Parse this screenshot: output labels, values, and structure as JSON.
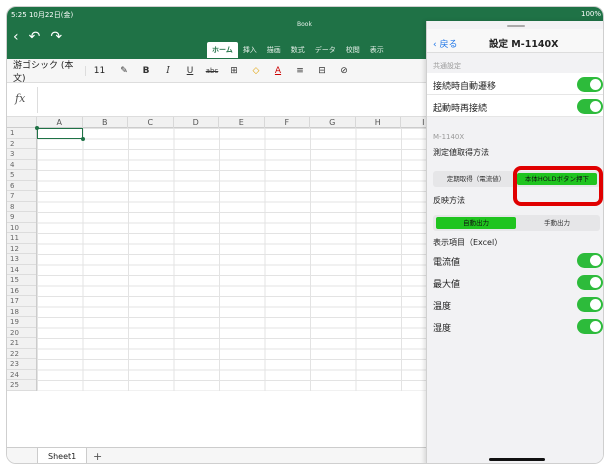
{
  "status": {
    "time": "5:25 10月22日(金)",
    "battery": "100%"
  },
  "doc_title": "Book",
  "ribbon_tabs": [
    "ホーム",
    "挿入",
    "描画",
    "数式",
    "データ",
    "校閲",
    "表示"
  ],
  "toolbar": {
    "font": "游ゴシック (本文)",
    "size": "11",
    "bold": "B",
    "italic": "I",
    "underline": "U",
    "strike": "abc"
  },
  "formula": {
    "fx": "fx"
  },
  "columns": [
    "A",
    "B",
    "C",
    "D",
    "E",
    "F",
    "G",
    "H",
    "I"
  ],
  "rows": [
    "1",
    "2",
    "3",
    "4",
    "5",
    "6",
    "7",
    "8",
    "9",
    "10",
    "11",
    "12",
    "13",
    "14",
    "15",
    "16",
    "17",
    "18",
    "19",
    "20",
    "21",
    "22",
    "23",
    "24",
    "25"
  ],
  "sheet_tab": "Sheet1",
  "add_sheet": "+",
  "panel": {
    "back": "戻る",
    "title": "設定 M-1140X",
    "common_section": "共通設定",
    "auto_transition": "接続時自動遷移",
    "auto_reconnect": "起動時再接続",
    "device_section": "M-1140X",
    "measure_method": "測定値取得方法",
    "periodic": "定期取得（電流値）",
    "hold_button": "本体HOLDボタン押下",
    "reflect_method": "反映方法",
    "auto_output": "自動出力",
    "manual_output": "手動出力",
    "display_items": "表示項目（Excel）",
    "item1": "電流値",
    "item2": "最大値",
    "item3": "温度",
    "item4": "湿度"
  }
}
